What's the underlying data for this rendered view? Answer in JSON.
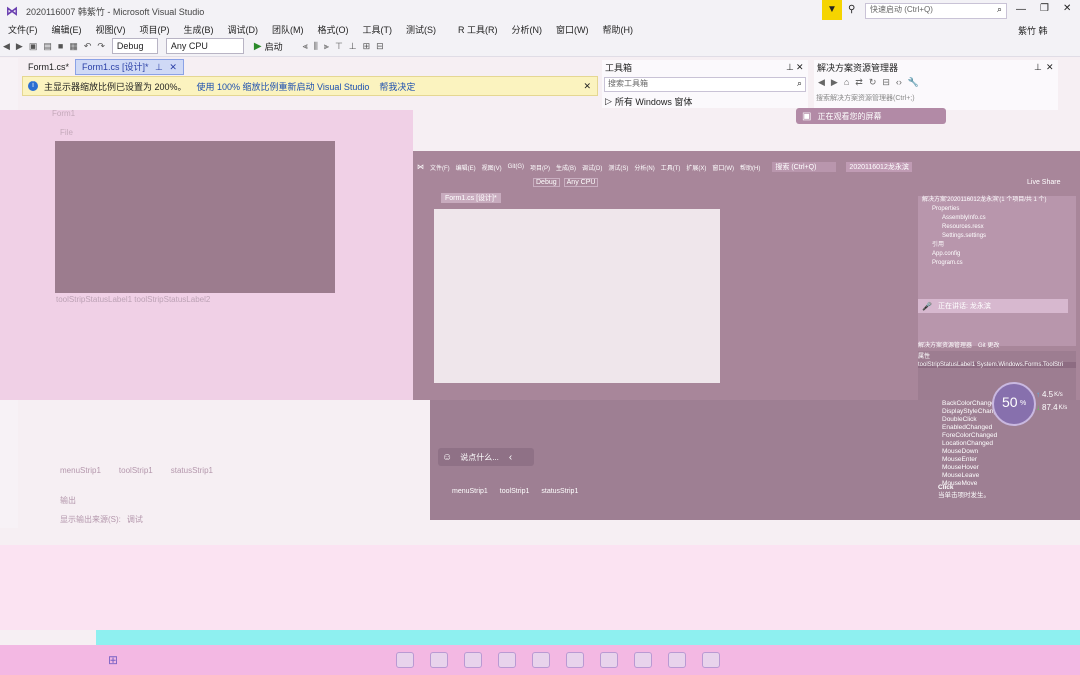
{
  "window": {
    "title": "2020116007 韩紫竹 - Microsoft Visual Studio",
    "app_icon": "vs-logo-icon"
  },
  "quick_launch": {
    "placeholder": "快速启动 (Ctrl+Q)"
  },
  "window_controls": [
    "minimize-icon",
    "maximize-icon",
    "close-icon"
  ],
  "user": {
    "name": "紫竹 韩"
  },
  "menus": [
    "文件(F)",
    "编辑(E)",
    "视图(V)",
    "项目(P)",
    "生成(B)",
    "调试(D)",
    "团队(M)",
    "格式(O)",
    "工具(T)",
    "测试(S)",
    "R 工具(R)",
    "分析(N)",
    "窗口(W)",
    "帮助(H)"
  ],
  "toolbar": {
    "config": "Debug",
    "platform": "Any CPU",
    "start_label": "启动"
  },
  "doc_tabs": [
    {
      "label": "Form1.cs*"
    },
    {
      "label": "Form1.cs [设计]*"
    }
  ],
  "infobar": {
    "message": "主显示器缩放比例已设置为 200%。",
    "link1": "使用 100% 缩放比例重新启动 Visual Studio",
    "link2": "帮我决定"
  },
  "toolbox": {
    "title": "工具箱",
    "search_placeholder": "搜索工具箱",
    "group": "所有 Windows 窗体"
  },
  "solution_explorer": {
    "title": "解决方案资源管理器",
    "search_placeholder": "搜索解决方案资源管理器(Ctrl+;)"
  },
  "overlay": {
    "sharing_banner": "正在观看您的屏幕",
    "speaker_banner": "正在讲话: 龙永滨"
  },
  "form_designer": {
    "form_title": "Form1",
    "menu_label": "File",
    "status_items": "toolStripStatusLabel1 toolStripStatusLabel2",
    "components": [
      "menuStrip1",
      "toolStrip1",
      "statusStrip1"
    ]
  },
  "remote_vs": {
    "menus": [
      "文件(F)",
      "编辑(E)",
      "视图(V)",
      "Git(G)",
      "项目(P)",
      "生成(B)",
      "调试(D)",
      "测试(S)",
      "分析(N)",
      "工具(T)",
      "扩展(X)",
      "窗口(W)",
      "帮助(H)"
    ],
    "search": "搜索 (Ctrl+Q)",
    "project": "2020116012龙永滨",
    "live_share": "Live Share",
    "config": "Debug",
    "platform": "Any CPU",
    "tab": "Form1.cs [设计]*",
    "tree": [
      "解决方案'2020116012龙永滨'(1 个项目/共 1 个)",
      "Properties",
      "AssemblyInfo.cs",
      "Resources.resx",
      "Settings.settings",
      "引用",
      "App.config",
      "Program.cs"
    ],
    "bottom_tabs": [
      "解决方案资源管理器",
      "Git 更改"
    ],
    "properties_title": "属性",
    "properties_object": "toolStripStatusLabel1 System.Windows.Forms.ToolStri",
    "events": [
      "BackColorChanged",
      "DisplayStyleChang",
      "DoubleClick",
      "EnabledChanged",
      "ForeColorChanged",
      "LocationChanged",
      "MouseDown",
      "MouseEnter",
      "MouseHover",
      "MouseLeave",
      "MouseMove"
    ],
    "click_title": "Click",
    "click_desc": "当单击项时发生。",
    "components": [
      "menuStrip1",
      "toolStrip1",
      "statusStrip1"
    ]
  },
  "network_widget": {
    "percent": "50",
    "unit": "%",
    "up": "4.5",
    "up_unit": "K/s",
    "down": "87.4",
    "down_unit": "K/s"
  },
  "chat": {
    "placeholder": "说点什么..."
  },
  "output_panel": {
    "label1": "输出",
    "label2": "显示输出来源(S):",
    "value": "调试"
  },
  "colors": {
    "accent": "#8ba2e6",
    "infobar": "#fbf3bf",
    "taskbar": "#f3b8e3",
    "remote_bg": "#a8869a"
  }
}
